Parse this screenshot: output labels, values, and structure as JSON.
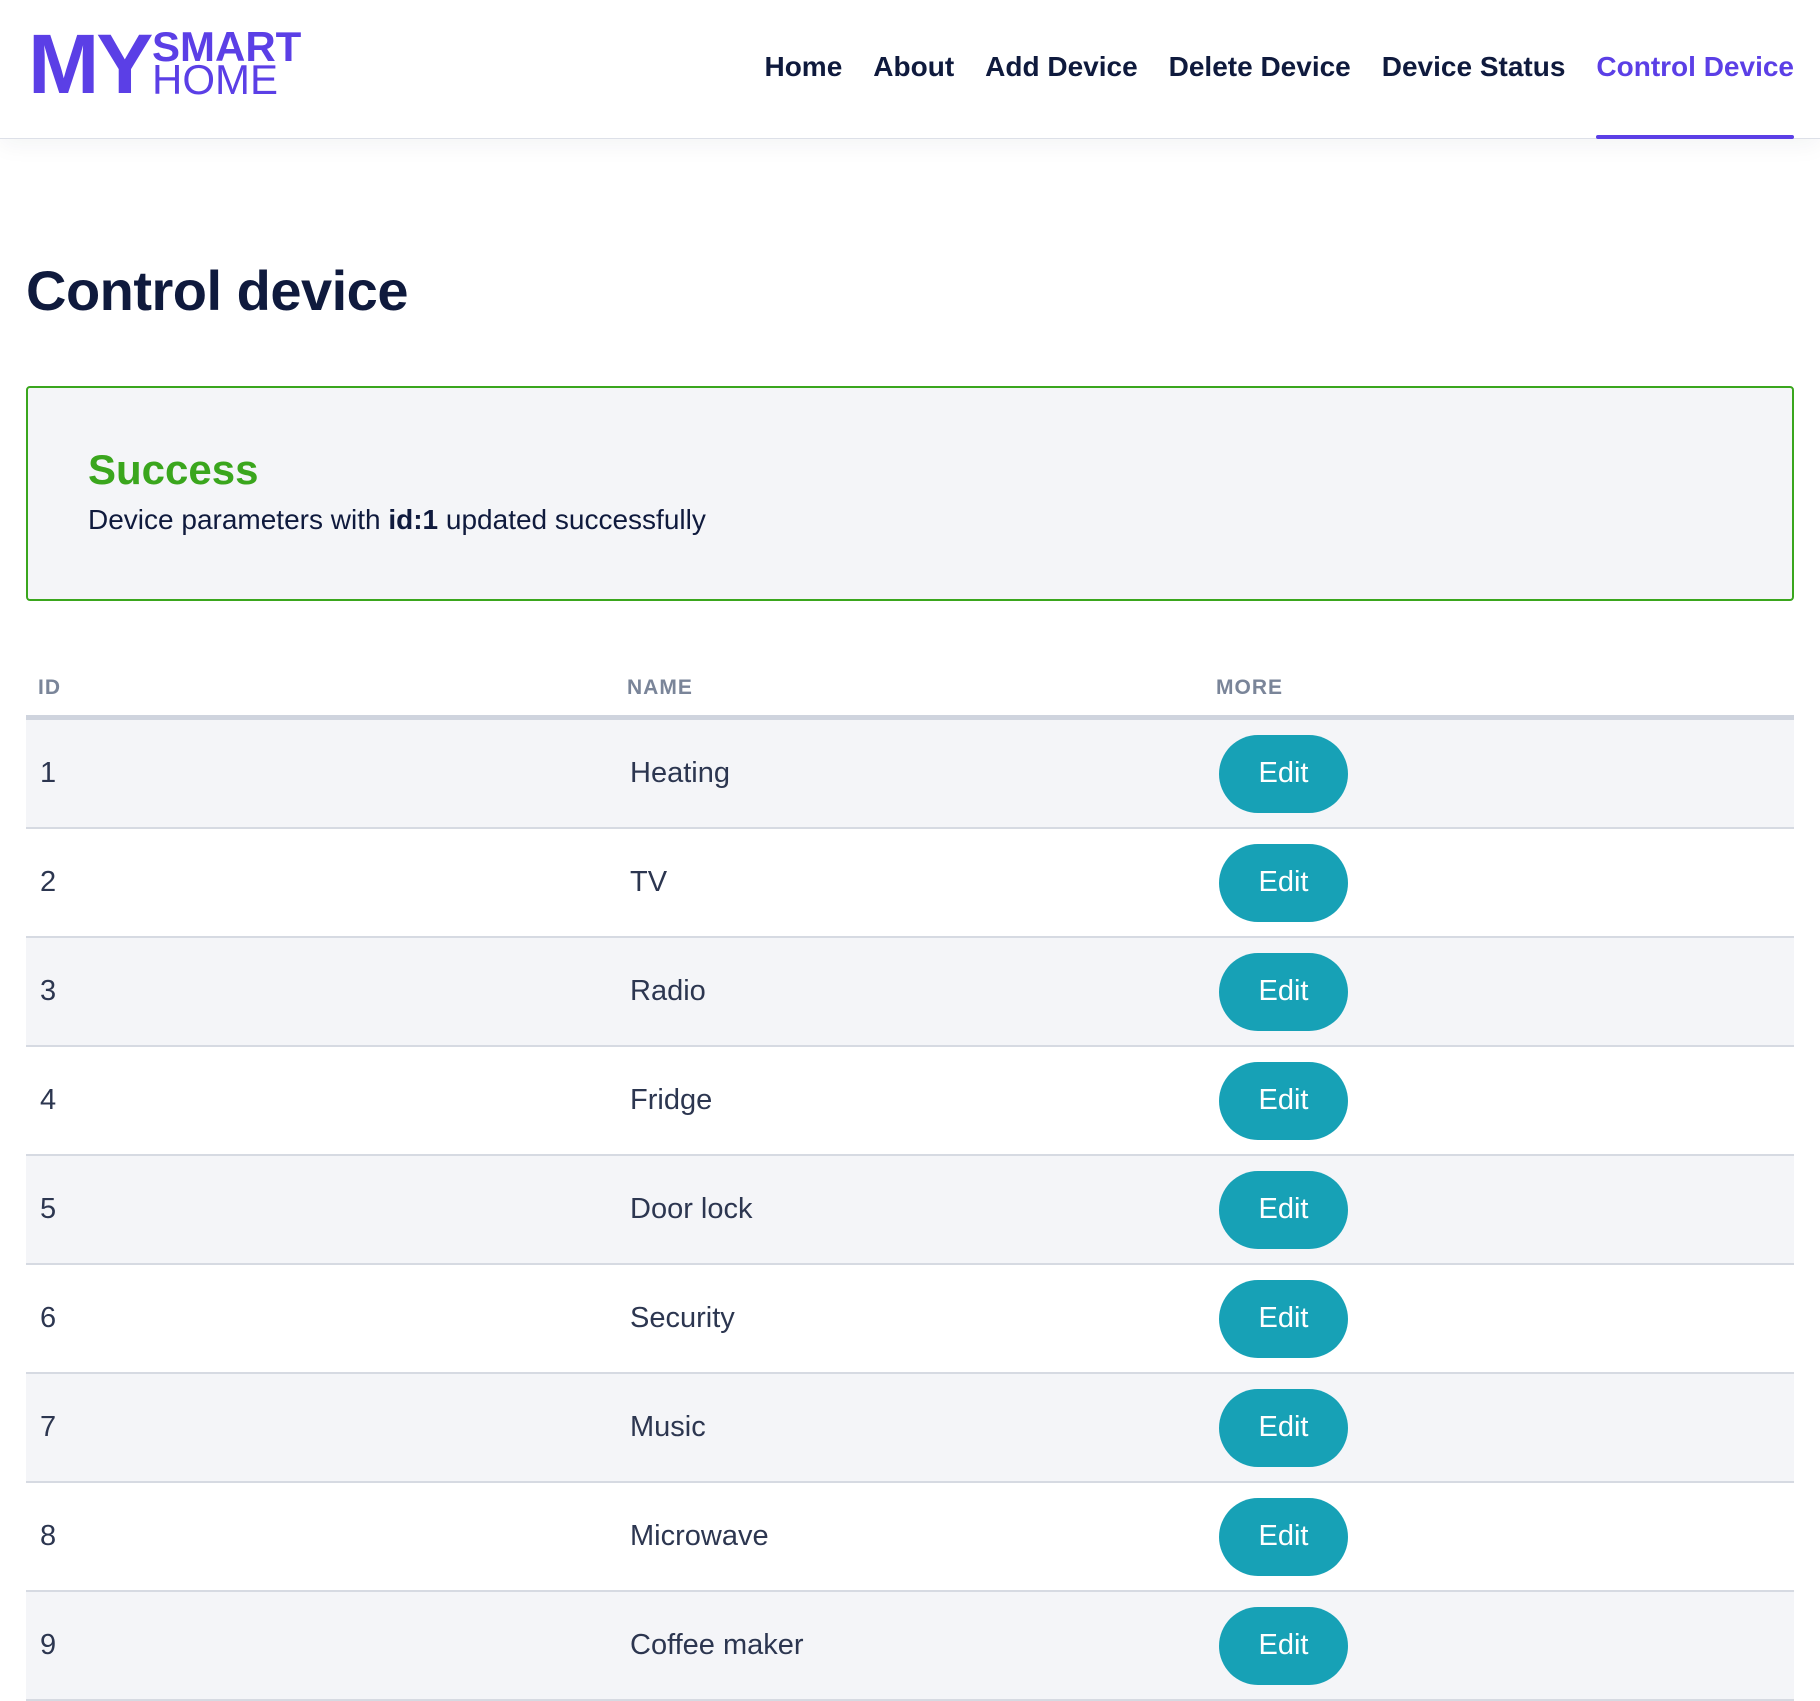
{
  "logo": {
    "my": "MY",
    "smart": "SMART",
    "home": "HOME"
  },
  "nav": {
    "items": [
      {
        "label": "Home",
        "active": false
      },
      {
        "label": "About",
        "active": false
      },
      {
        "label": "Add Device",
        "active": false
      },
      {
        "label": "Delete Device",
        "active": false
      },
      {
        "label": "Device Status",
        "active": false
      },
      {
        "label": "Control Device",
        "active": true
      }
    ]
  },
  "page": {
    "title": "Control device"
  },
  "alert": {
    "title": "Success",
    "message_prefix": "Device parameters with ",
    "message_id": "id:1",
    "message_suffix": " updated successfully",
    "color": "#3aa61d"
  },
  "table": {
    "headers": {
      "id": "ID",
      "name": "NAME",
      "more": "MORE"
    },
    "edit_label": "Edit",
    "rows": [
      {
        "id": "1",
        "name": "Heating"
      },
      {
        "id": "2",
        "name": "TV"
      },
      {
        "id": "3",
        "name": "Radio"
      },
      {
        "id": "4",
        "name": "Fridge"
      },
      {
        "id": "5",
        "name": "Door lock"
      },
      {
        "id": "6",
        "name": "Security"
      },
      {
        "id": "7",
        "name": "Music"
      },
      {
        "id": "8",
        "name": "Microwave"
      },
      {
        "id": "9",
        "name": "Coffee maker"
      }
    ]
  },
  "colors": {
    "brand": "#5b3fe6",
    "button": "#17a1b6",
    "text": "#0f1a3d"
  }
}
